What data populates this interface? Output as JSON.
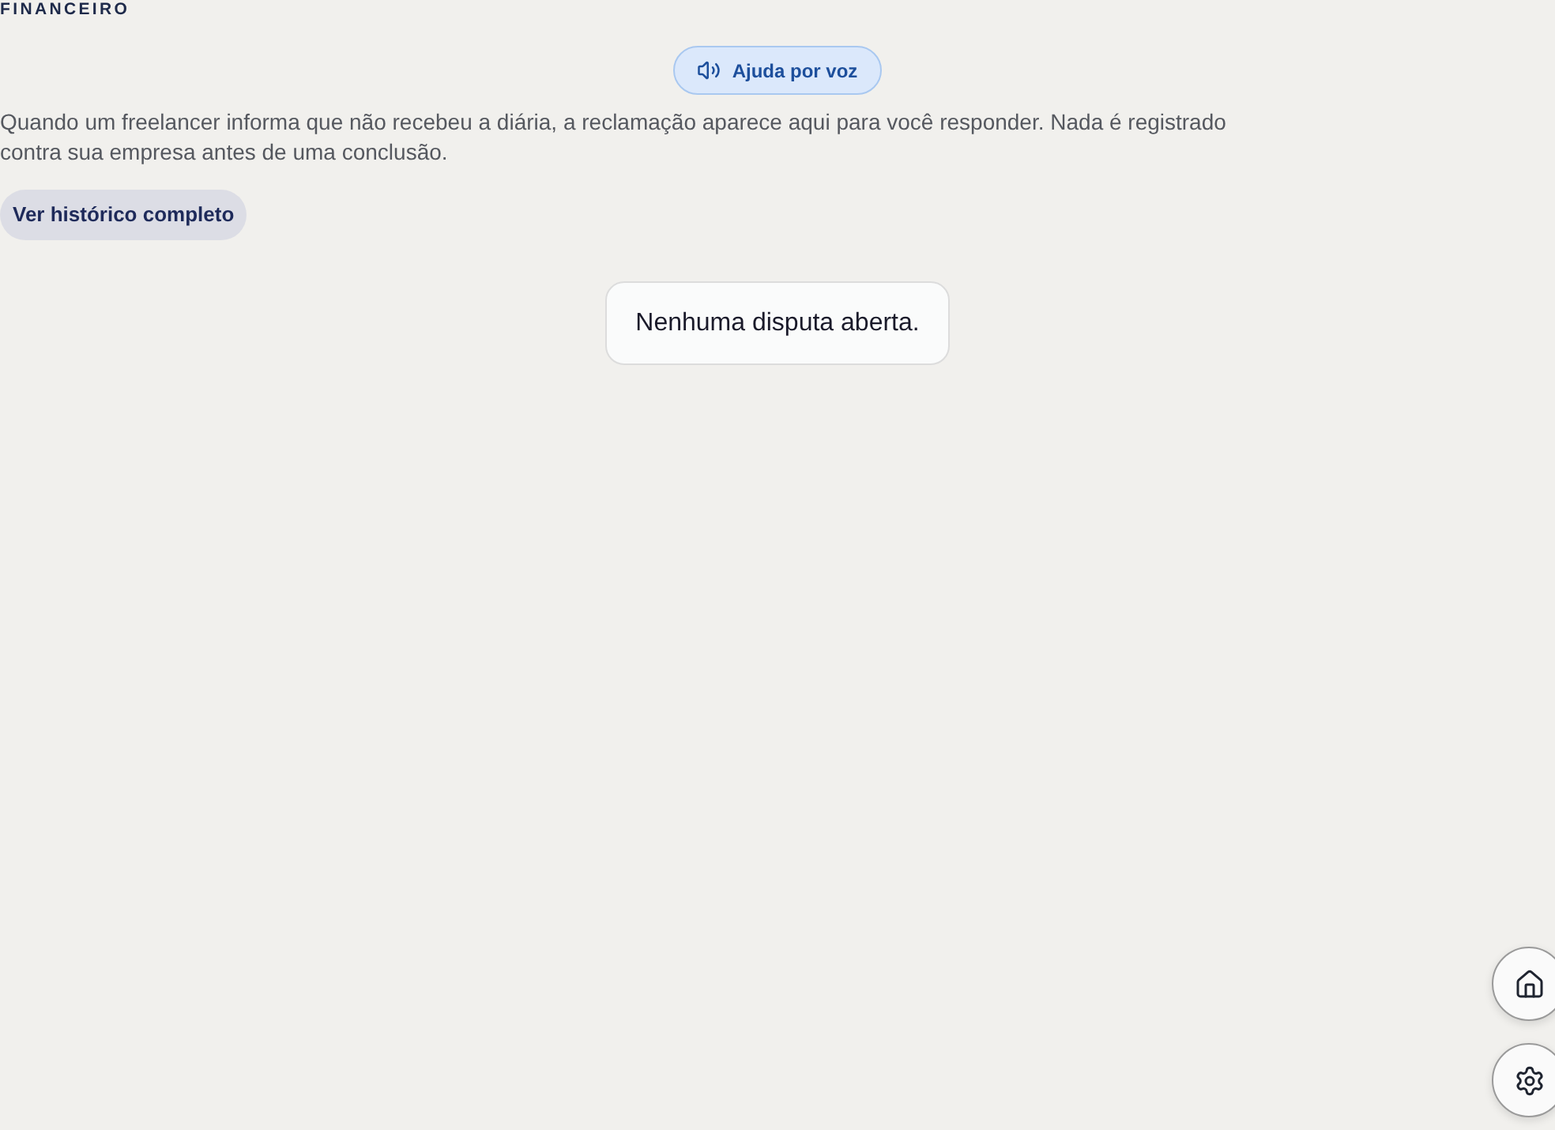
{
  "section_label": "FINANCEIRO",
  "voice_help_button": {
    "label": "Ajuda por voz"
  },
  "description": "Quando um freelancer informa que não recebeu a diária, a reclamação aparece aqui para você responder. Nada é registrado contra sua empresa antes de uma conclusão.",
  "history_button": {
    "label": "Ver histórico completo"
  },
  "empty_state": {
    "message": "Nenhuma disputa aberta."
  },
  "floating_buttons": [
    {
      "kind": "home"
    },
    {
      "kind": "settings"
    }
  ]
}
